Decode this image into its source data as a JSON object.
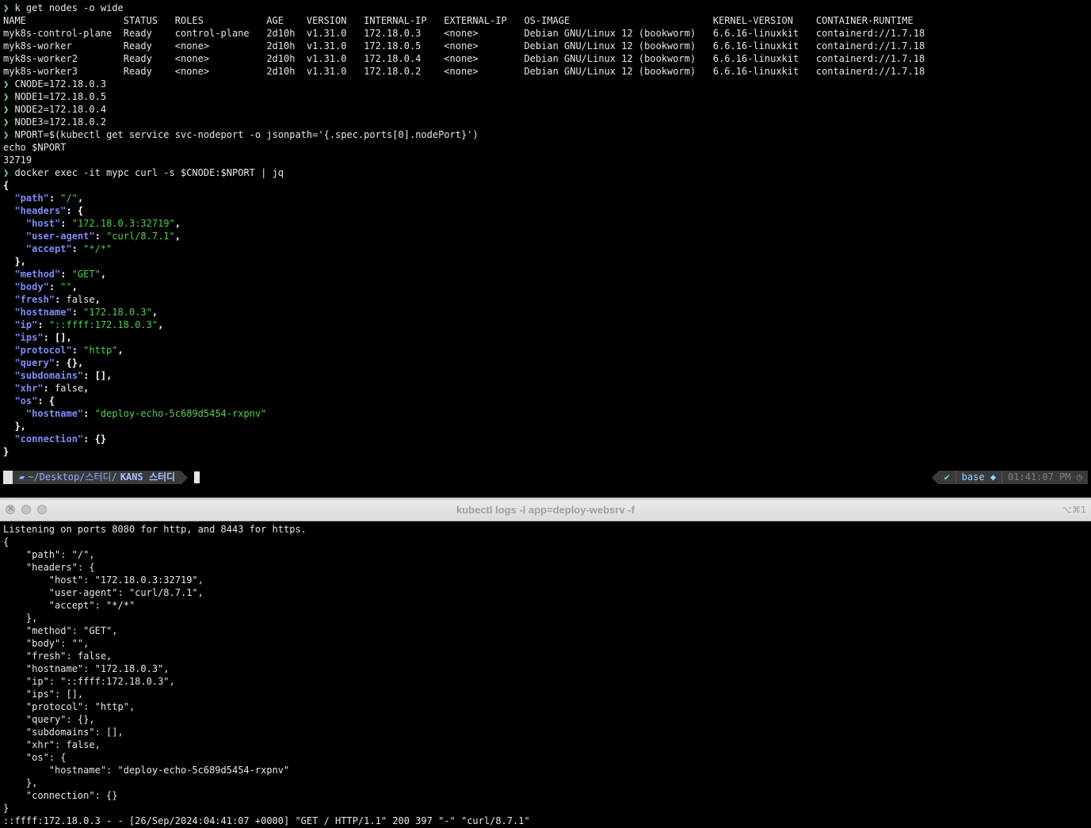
{
  "top": {
    "cmd1": "k get nodes -o wide",
    "table": [
      "NAME                 STATUS   ROLES           AGE    VERSION   INTERNAL-IP   EXTERNAL-IP   OS-IMAGE                         KERNEL-VERSION    CONTAINER-RUNTIME",
      "myk8s-control-plane  Ready    control-plane   2d10h  v1.31.0   172.18.0.3    <none>        Debian GNU/Linux 12 (bookworm)   6.6.16-linuxkit   containerd://1.7.18",
      "myk8s-worker         Ready    <none>          2d10h  v1.31.0   172.18.0.5    <none>        Debian GNU/Linux 12 (bookworm)   6.6.16-linuxkit   containerd://1.7.18",
      "myk8s-worker2        Ready    <none>          2d10h  v1.31.0   172.18.0.4    <none>        Debian GNU/Linux 12 (bookworm)   6.6.16-linuxkit   containerd://1.7.18",
      "myk8s-worker3        Ready    <none>          2d10h  v1.31.0   172.18.0.2    <none>        Debian GNU/Linux 12 (bookworm)   6.6.16-linuxkit   containerd://1.7.18"
    ],
    "cmd_cnode": "CNODE=172.18.0.3",
    "cmd_node1": "NODE1=172.18.0.5",
    "cmd_node2": "NODE2=172.18.0.4",
    "cmd_node3": "NODE3=172.18.0.2",
    "cmd_nport": "NPORT=$(kubectl get service svc-nodeport -o jsonpath='{.spec.ports[0].nodePort}')",
    "echo_line": "echo $NPORT",
    "nport_value": "32719",
    "cmd_curl": "docker exec -it mypc curl -s $CNODE:$NPORT | jq",
    "json": {
      "path": "\"/\"",
      "host": "\"172.18.0.3:32719\"",
      "user_agent": "\"curl/8.7.1\"",
      "accept": "\"*/*\"",
      "method": "\"GET\"",
      "body": "\"\"",
      "fresh": "false",
      "hostname": "\"172.18.0.3\"",
      "ip": "\"::ffff:172.18.0.3\"",
      "ips": "[]",
      "protocol": "\"http\"",
      "query": "{}",
      "subdomains": "[]",
      "xhr": "false",
      "os_hostname": "\"deploy-echo-5c689d5454-rxpnv\"",
      "connection": "{}"
    },
    "prompt_symbol": "❯",
    "powerline": {
      "apple": "",
      "path_prefix": "~/Desktop/스터디/",
      "path_current": "KANS 스터디",
      "status_ok": "✔",
      "env": "base",
      "time": "01:41:07 PM"
    }
  },
  "bottom_window": {
    "title": "kubectl logs -l app=deploy-websrv -f",
    "shortcut": "⌥⌘1",
    "lines": [
      "Listening on ports 8080 for http, and 8443 for https.",
      "{",
      "    \"path\": \"/\",",
      "    \"headers\": {",
      "        \"host\": \"172.18.0.3:32719\",",
      "        \"user-agent\": \"curl/8.7.1\",",
      "        \"accept\": \"*/*\"",
      "    },",
      "    \"method\": \"GET\",",
      "    \"body\": \"\",",
      "    \"fresh\": false,",
      "    \"hostname\": \"172.18.0.3\",",
      "    \"ip\": \"::ffff:172.18.0.3\",",
      "    \"ips\": [],",
      "    \"protocol\": \"http\",",
      "    \"query\": {},",
      "    \"subdomains\": [],",
      "    \"xhr\": false,",
      "    \"os\": {",
      "        \"hostname\": \"deploy-echo-5c689d5454-rxpnv\"",
      "    },",
      "    \"connection\": {}",
      "}",
      "::ffff:172.18.0.3 - - [26/Sep/2024:04:41:07 +0000] \"GET / HTTP/1.1\" 200 397 \"-\" \"curl/8.7.1\""
    ]
  }
}
